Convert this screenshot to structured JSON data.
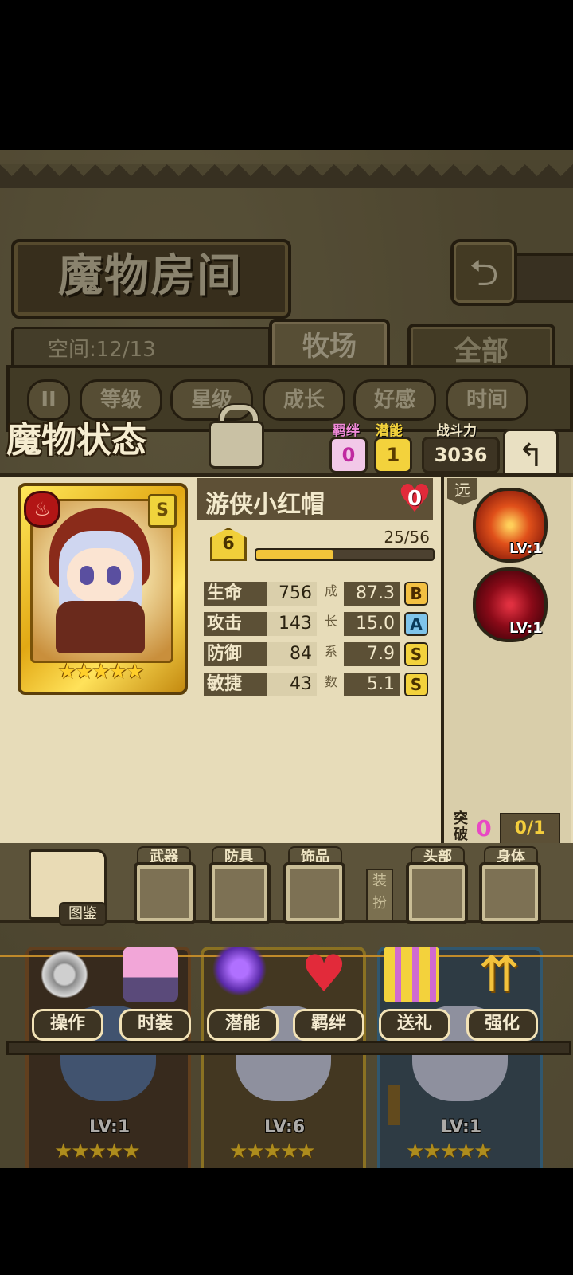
{
  "header": {
    "title": "魔物房间",
    "back_icon": "return-arrow-icon"
  },
  "space": {
    "label": "空间:12/13"
  },
  "tabs": [
    {
      "label": "牧场",
      "active": true
    },
    {
      "label": "全部",
      "active": false
    }
  ],
  "filters": {
    "sort_icon": "II",
    "items": [
      "等级",
      "星级",
      "成长",
      "好感",
      "时间"
    ]
  },
  "status": {
    "title": "魔物状态",
    "bond": {
      "label": "羁绊",
      "value": "0"
    },
    "potential": {
      "label": "潜能",
      "value": "1"
    },
    "power": {
      "label": "战斗力",
      "value": "3036"
    }
  },
  "monster": {
    "name": "游侠小红帽",
    "affection": "0",
    "rank": "S",
    "level": "6",
    "exp_text": "25/56",
    "exp_fraction": 0.446,
    "stars": "★★★★★",
    "element_icon": "fire-icon",
    "stats": [
      {
        "label": "生命",
        "value": "756",
        "growth": "87.3",
        "grade": "B"
      },
      {
        "label": "攻击",
        "value": "143",
        "growth": "15.0",
        "grade": "A"
      },
      {
        "label": "防御",
        "value": "84",
        "growth": "7.9",
        "grade": "S"
      },
      {
        "label": "敏捷",
        "value": "43",
        "growth": "5.1",
        "grade": "S"
      }
    ],
    "growth_vertical": [
      "成",
      "长",
      "系",
      "数"
    ],
    "range": "远",
    "skills": [
      {
        "level": "LV:1",
        "icon": "arrow-strike-icon"
      },
      {
        "level": "LV:1",
        "icon": "blood-swirl-icon"
      }
    ],
    "breakthrough": {
      "label_top": "突",
      "label_bottom": "破",
      "value": "0",
      "progress": "0/1"
    }
  },
  "equipment": {
    "book_label": "图鉴",
    "slots": [
      "武器",
      "防具",
      "饰品",
      "头部",
      "身体"
    ],
    "dressup_top": "装",
    "dressup_bottom": "扮"
  },
  "actions": [
    "操作",
    "时装",
    "潜能",
    "羁绊",
    "送礼",
    "强化"
  ],
  "cards": [
    {
      "level": "LV:1",
      "stars": "★★★★★",
      "frame": "#8a5a2c"
    },
    {
      "level": "LV:6",
      "stars": "★★★★★",
      "frame": "#c9a632"
    },
    {
      "level": "LV:1",
      "stars": "★★★★★",
      "frame": "#3f7fa8"
    }
  ],
  "colors": {
    "gold": "#f2c43a",
    "panel": "#e7dcb9",
    "dark": "#2c2415",
    "pink": "#e848c4"
  }
}
